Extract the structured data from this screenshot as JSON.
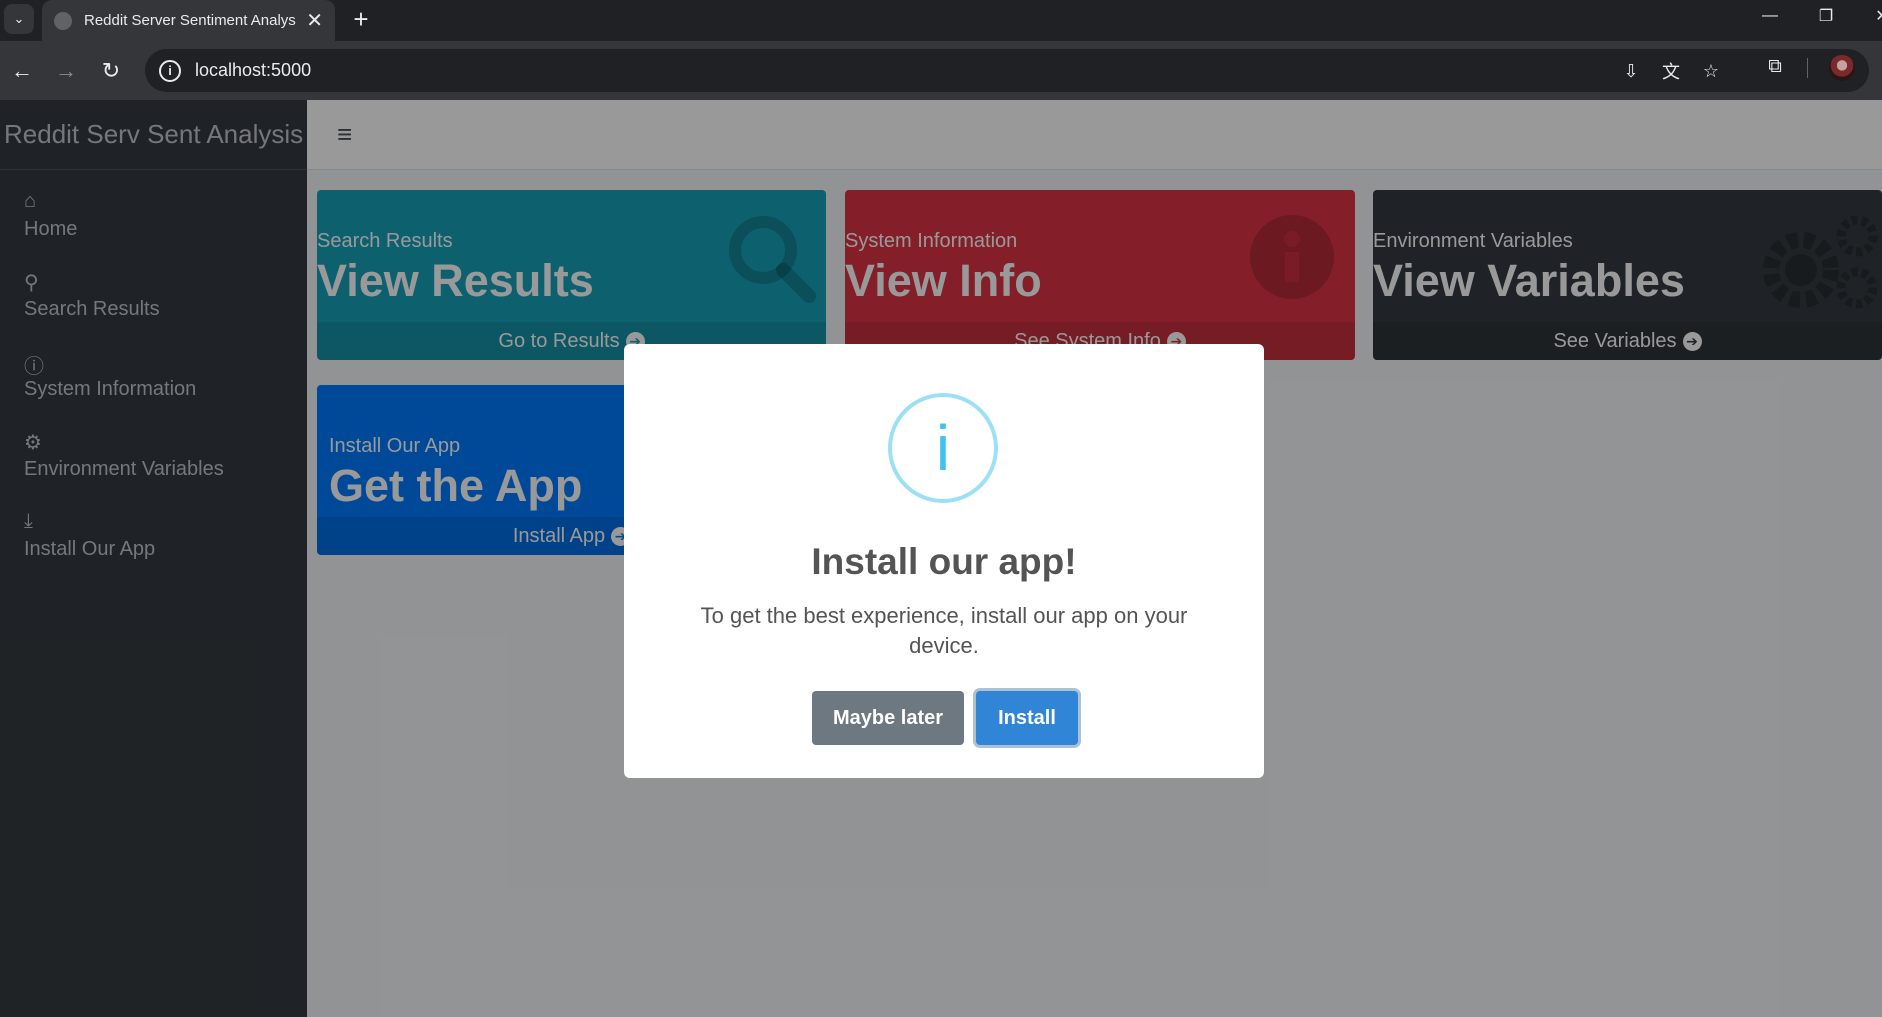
{
  "browser": {
    "tab_title": "Reddit Server Sentiment Analys",
    "tab_close": "✕",
    "new_tab": "+",
    "url": "localhost:5000"
  },
  "sidebar": {
    "brand": "Reddit Serv Sent Analysis",
    "items": [
      {
        "label": "Home",
        "icon": "home-icon"
      },
      {
        "label": "Search Results",
        "icon": "search-icon"
      },
      {
        "label": "System Information",
        "icon": "info-circle-icon"
      },
      {
        "label": "Environment Variables",
        "icon": "cogs-icon"
      },
      {
        "label": "Install Our App",
        "icon": "download-icon"
      }
    ]
  },
  "boxes": [
    {
      "subtitle": "Search Results",
      "title": "View Results",
      "footer": "Go to Results",
      "color": "#17a2b8"
    },
    {
      "subtitle": "System Information",
      "title": "View Info",
      "footer": "See System Info",
      "color": "#dc3545"
    },
    {
      "subtitle": "Environment Variables",
      "title": "View Variables",
      "footer": "See Variables",
      "color": "#343a40"
    },
    {
      "subtitle": "Install Our App",
      "title": "Get the App",
      "footer": "Install App",
      "color": "#007bff"
    }
  ],
  "modal": {
    "icon": "i",
    "title": "Install our app!",
    "text": "To get the best experience, install our app on your device.",
    "later_label": "Maybe later",
    "install_label": "Install"
  },
  "colors": {
    "accent": "#3085d6",
    "info": "#17a2b8",
    "danger": "#dc3545",
    "dark": "#343a40",
    "primary": "#007bff"
  }
}
